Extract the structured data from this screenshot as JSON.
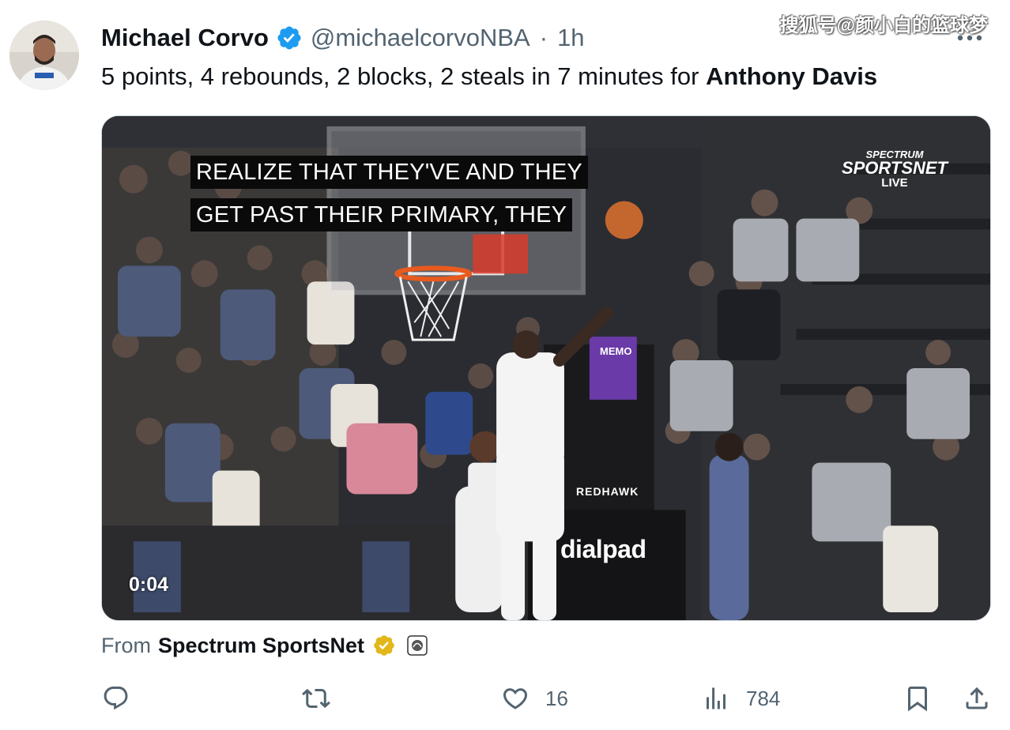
{
  "author": {
    "display_name": "Michael Corvo",
    "handle": "@michaelcorvoNBA",
    "separator": "·",
    "time": "1h"
  },
  "watermark": "搜狐号@颜小白的篮球梦",
  "tweet": {
    "text_prefix": "5 points, 4 rebounds, 2 blocks, 2 steals in 7 minutes for ",
    "mention": "Anthony Davis"
  },
  "video": {
    "caption_line1": "REALIZE THAT THEY'VE AND THEY",
    "caption_line2": "GET PAST THEIR PRIMARY, THEY",
    "network_logo_top": "SPECTRUM",
    "network_logo_main": "SPORTSNET",
    "network_logo_sub": "LIVE",
    "timestamp": "0:04",
    "court_ad_dialpad": "dialpad",
    "court_ad_redhawk": "REDHAWK",
    "court_ad_sign": "MEMO"
  },
  "source": {
    "prefix": "From",
    "name": "Spectrum SportsNet"
  },
  "actions": {
    "reply_count": "",
    "retweet_count": "",
    "like_count": "16",
    "view_count": "784"
  },
  "colors": {
    "verified_blue": "#1d9bf0",
    "verified_gold": "#e2b719",
    "muted_text": "#536471"
  },
  "icons": [
    "verified-badge-icon",
    "more-icon",
    "reply-icon",
    "retweet-icon",
    "like-icon",
    "views-icon",
    "bookmark-icon",
    "share-icon"
  ]
}
